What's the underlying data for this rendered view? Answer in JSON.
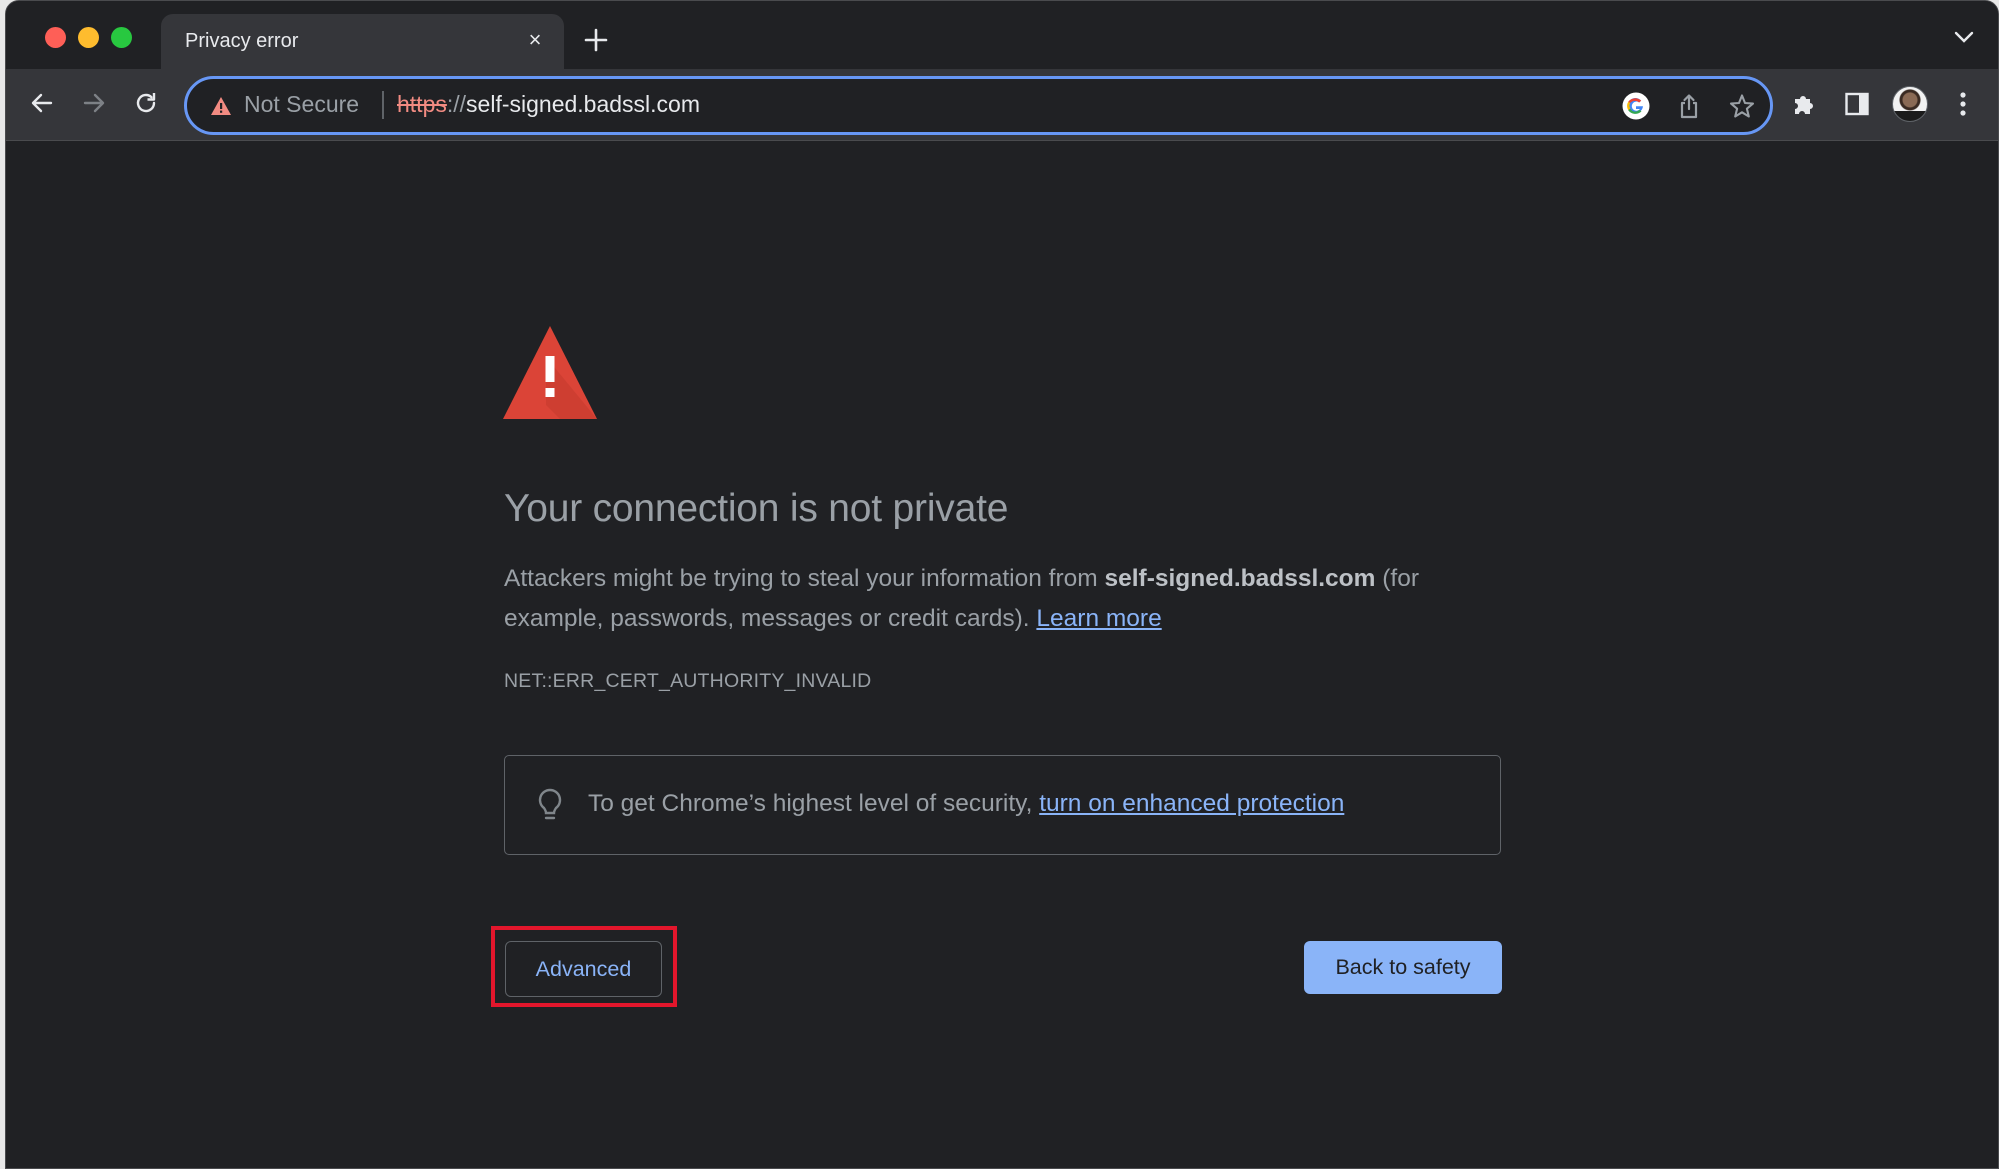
{
  "browser": {
    "tab": {
      "title": "Privacy error",
      "close_label": "×"
    },
    "new_tab_label": "+",
    "omnibox": {
      "security_label": "Not Secure",
      "url_scheme": "https",
      "url_separator": "://",
      "url_host": "self-signed.badssl.com"
    },
    "icons": {
      "back": "arrow-left-icon",
      "forward": "arrow-right-icon",
      "reload": "reload-icon",
      "google_lens": "google-icon",
      "share": "share-icon",
      "bookmark": "star-icon",
      "extensions": "puzzle-icon",
      "side_panel": "side-panel-icon",
      "profile": "avatar",
      "menu": "kebab-menu-icon",
      "tab_search": "chevron-down-icon"
    }
  },
  "page": {
    "heading": "Your connection is not private",
    "paragraph": {
      "before": "Attackers might be trying to steal your information from ",
      "host": "self-signed.badssl.com",
      "after": " (for example, passwords, messages or credit cards). ",
      "learn_more": "Learn more"
    },
    "error_code": "NET::ERR_CERT_AUTHORITY_INVALID",
    "tip": {
      "text": "To get Chrome’s highest level of security, ",
      "link": "turn on enhanced protection"
    },
    "buttons": {
      "advanced": "Advanced",
      "back_to_safety": "Back to safety"
    }
  },
  "colors": {
    "accent": "#8ab4f8",
    "warning_red": "#db4437",
    "highlight_box": "#e3162c",
    "background": "#202124"
  }
}
